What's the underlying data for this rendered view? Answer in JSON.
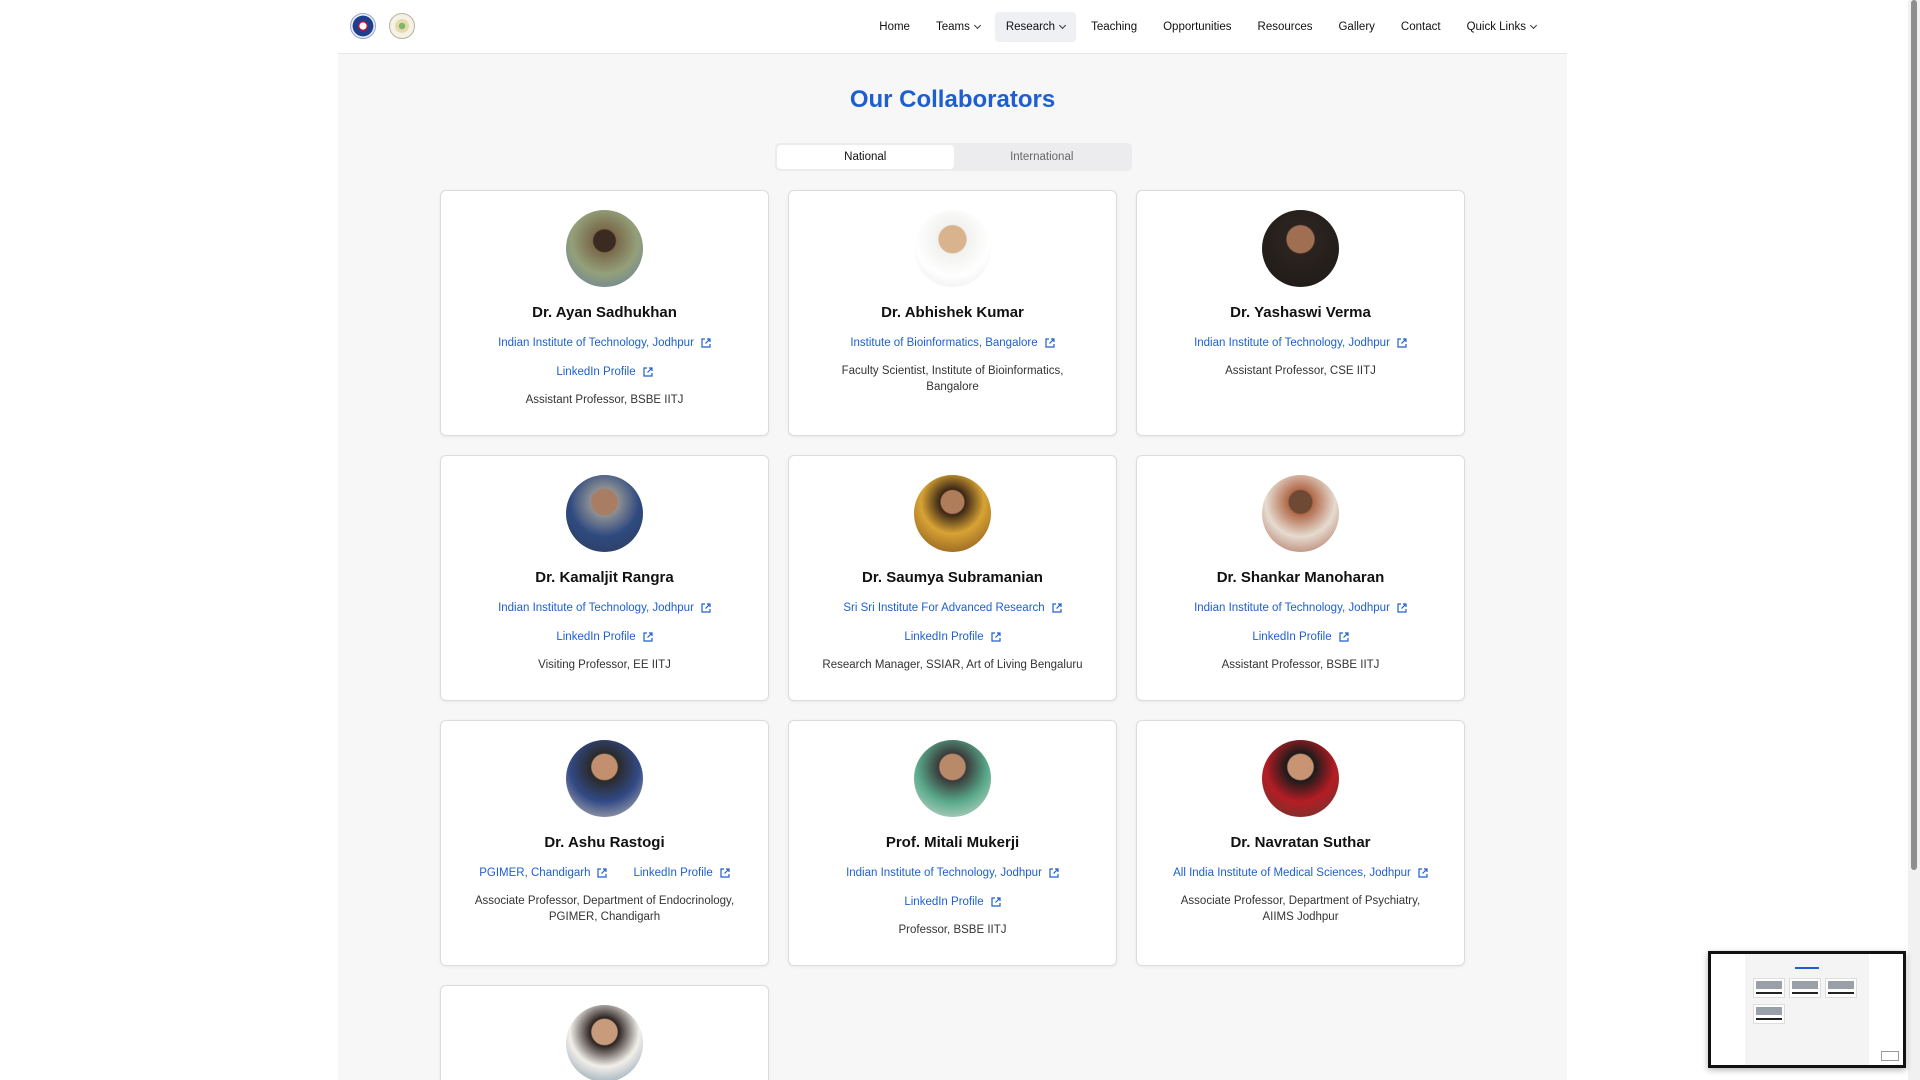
{
  "nav": {
    "items": [
      {
        "label": "Home"
      },
      {
        "label": "Teams"
      },
      {
        "label": "Research"
      },
      {
        "label": "Teaching"
      },
      {
        "label": "Opportunities"
      },
      {
        "label": "Resources"
      },
      {
        "label": "Gallery"
      },
      {
        "label": "Contact"
      },
      {
        "label": "Quick Links"
      }
    ],
    "active": "Research"
  },
  "main": {
    "title": "Our Collaborators",
    "tabs": [
      {
        "label": "National",
        "selected": true
      },
      {
        "label": "International",
        "selected": false
      }
    ]
  },
  "collaborators": [
    {
      "name": "Dr. Ayan Sadhukhan",
      "institution": "Indian Institute of Technology, Jodhpur",
      "linkedin": "LinkedIn Profile",
      "role": "Assistant Professor, BSBE IITJ"
    },
    {
      "name": "Dr. Abhishek Kumar",
      "institution": "Institute of Bioinformatics, Bangalore",
      "role": "Faculty Scientist, Institute of Bioinformatics, Bangalore"
    },
    {
      "name": "Dr. Yashaswi Verma",
      "institution": "Indian Institute of Technology, Jodhpur",
      "role": "Assistant Professor, CSE IITJ"
    },
    {
      "name": "Dr. Kamaljit Rangra",
      "institution": "Indian Institute of Technology, Jodhpur",
      "linkedin": "LinkedIn Profile",
      "role": "Visiting Professor, EE IITJ"
    },
    {
      "name": "Dr. Saumya Subramanian",
      "institution": "Sri Sri Institute For Advanced Research",
      "linkedin": "LinkedIn Profile",
      "role": "Research Manager, SSIAR, Art of Living Bengaluru"
    },
    {
      "name": "Dr. Shankar Manoharan",
      "institution": "Indian Institute of Technology, Jodhpur",
      "linkedin": "LinkedIn Profile",
      "role": "Assistant Professor, BSBE IITJ"
    },
    {
      "name": "Dr. Ashu Rastogi",
      "institution": "PGIMER, Chandigarh",
      "linkedin": "LinkedIn Profile",
      "role": "Associate Professor, Department of Endocrinology, PGIMER, Chandigarh"
    },
    {
      "name": "Prof. Mitali Mukerji",
      "institution": "Indian Institute of Technology, Jodhpur",
      "linkedin": "LinkedIn Profile",
      "role": "Professor, BSBE IITJ"
    },
    {
      "name": "Dr. Navratan Suthar",
      "institution": "All India Institute of Medical Sciences, Jodhpur",
      "role": "Associate Professor, Department of Psychiatry, AIIMS Jodhpur"
    }
  ],
  "icons": {
    "external_link": "external-link-icon",
    "chevron": "chevron-down-icon"
  },
  "colors": {
    "accent": "#1d5fd1",
    "page_bg": "#f7f7f8"
  }
}
